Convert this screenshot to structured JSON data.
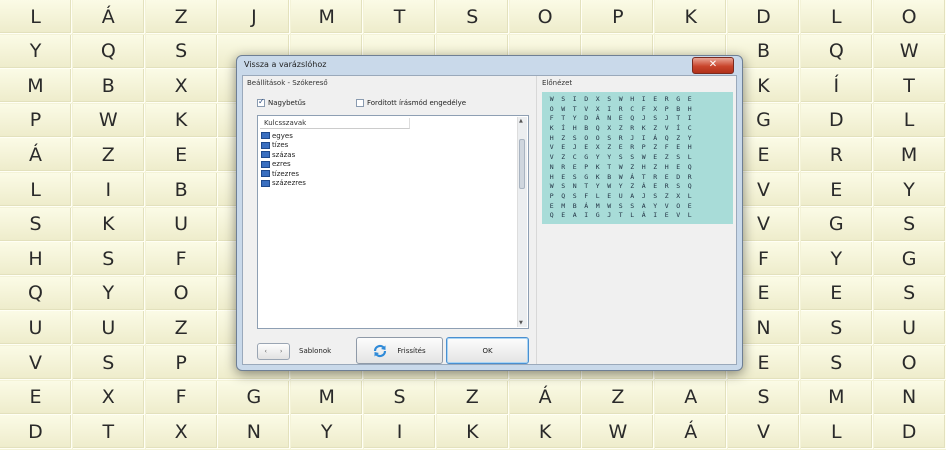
{
  "background_grid": [
    [
      "L",
      "Á",
      "Z",
      "J",
      "M",
      "T",
      "S",
      "O",
      "P",
      "K",
      "D",
      "L",
      "O"
    ],
    [
      "Y",
      "Q",
      "S",
      "",
      "",
      "",
      "",
      "",
      "",
      "",
      "B",
      "Q",
      "W"
    ],
    [
      "M",
      "B",
      "X",
      "",
      "",
      "",
      "",
      "",
      "",
      "",
      "K",
      "Í",
      "T"
    ],
    [
      "P",
      "W",
      "K",
      "",
      "",
      "",
      "",
      "",
      "",
      "",
      "G",
      "D",
      "L"
    ],
    [
      "Á",
      "Z",
      "E",
      "",
      "",
      "",
      "",
      "",
      "",
      "",
      "E",
      "R",
      "M"
    ],
    [
      "L",
      "I",
      "B",
      "",
      "",
      "",
      "",
      "",
      "",
      "",
      "V",
      "E",
      "Y"
    ],
    [
      "S",
      "K",
      "U",
      "",
      "",
      "",
      "",
      "",
      "",
      "",
      "V",
      "G",
      "S"
    ],
    [
      "H",
      "S",
      "F",
      "",
      "",
      "",
      "",
      "",
      "",
      "",
      "F",
      "Y",
      "G"
    ],
    [
      "Q",
      "Y",
      "O",
      "",
      "",
      "",
      "",
      "",
      "",
      "",
      "E",
      "E",
      "S"
    ],
    [
      "U",
      "U",
      "Z",
      "",
      "",
      "",
      "",
      "",
      "",
      "",
      "N",
      "S",
      "U"
    ],
    [
      "V",
      "S",
      "P",
      "",
      "",
      "",
      "",
      "",
      "",
      "",
      "E",
      "S",
      "O"
    ],
    [
      "E",
      "X",
      "F",
      "G",
      "M",
      "S",
      "Z",
      "Á",
      "Z",
      "A",
      "S",
      "M",
      "N"
    ],
    [
      "D",
      "T",
      "X",
      "N",
      "Y",
      "I",
      "K",
      "K",
      "W",
      "Á",
      "V",
      "L",
      "D"
    ]
  ],
  "dialog": {
    "title": "Vissza a varázslóhoz",
    "close_icon": "close-icon",
    "settings_label": "Beállítások - Szókereső",
    "checkbox_uppercase": {
      "label": "Nagybetűs",
      "checked": true
    },
    "checkbox_reverse": {
      "label": "Fordított írásmód engedélye",
      "checked": false
    },
    "keywords": {
      "header": "Kulcsszavak",
      "items": [
        "egyes",
        "tízes",
        "százas",
        "ezres",
        "tízezres",
        "százezres"
      ]
    },
    "preview_label": "Előnézet",
    "preview_grid": [
      [
        "W",
        "S",
        "I",
        "D",
        "X",
        "S",
        "W",
        "H",
        "I",
        "E",
        "R",
        "G",
        "E"
      ],
      [
        "O",
        "W",
        "T",
        "V",
        "X",
        "I",
        "R",
        "C",
        "F",
        "X",
        "P",
        "B",
        "H"
      ],
      [
        "F",
        "T",
        "Y",
        "D",
        "Á",
        "N",
        "E",
        "Q",
        "J",
        "S",
        "J",
        "T",
        "I"
      ],
      [
        "K",
        "Í",
        "H",
        "B",
        "Q",
        "X",
        "Z",
        "R",
        "K",
        "Z",
        "V",
        "Í",
        "C"
      ],
      [
        "H",
        "Z",
        "S",
        "O",
        "O",
        "S",
        "R",
        "J",
        "I",
        "Á",
        "Q",
        "Z",
        "Y"
      ],
      [
        "V",
        "E",
        "J",
        "E",
        "X",
        "Z",
        "E",
        "R",
        "P",
        "Z",
        "F",
        "E",
        "H"
      ],
      [
        "V",
        "Z",
        "C",
        "G",
        "Y",
        "Y",
        "S",
        "S",
        "W",
        "E",
        "Z",
        "S",
        "L"
      ],
      [
        "N",
        "R",
        "E",
        "P",
        "K",
        "T",
        "W",
        "Z",
        "H",
        "Z",
        "H",
        "E",
        "Q"
      ],
      [
        "H",
        "E",
        "S",
        "G",
        "K",
        "B",
        "W",
        "Á",
        "T",
        "R",
        "E",
        "D",
        "R"
      ],
      [
        "W",
        "S",
        "N",
        "T",
        "Y",
        "W",
        "Y",
        "Z",
        "Á",
        "E",
        "R",
        "S",
        "Q"
      ],
      [
        "P",
        "Q",
        "S",
        "F",
        "L",
        "E",
        "U",
        "A",
        "J",
        "S",
        "Z",
        "X",
        "L"
      ],
      [
        "E",
        "M",
        "B",
        "Á",
        "M",
        "W",
        "S",
        "S",
        "A",
        "Y",
        "V",
        "O",
        "E"
      ],
      [
        "Q",
        "E",
        "A",
        "I",
        "G",
        "J",
        "T",
        "L",
        "Á",
        "I",
        "E",
        "V",
        "L"
      ]
    ],
    "pager": {
      "prev": "‹",
      "next": "›"
    },
    "templates_label": "Sablonok",
    "refresh_label": "Frissítés",
    "refresh_icon": "refresh-icon",
    "ok_label": "OK"
  }
}
